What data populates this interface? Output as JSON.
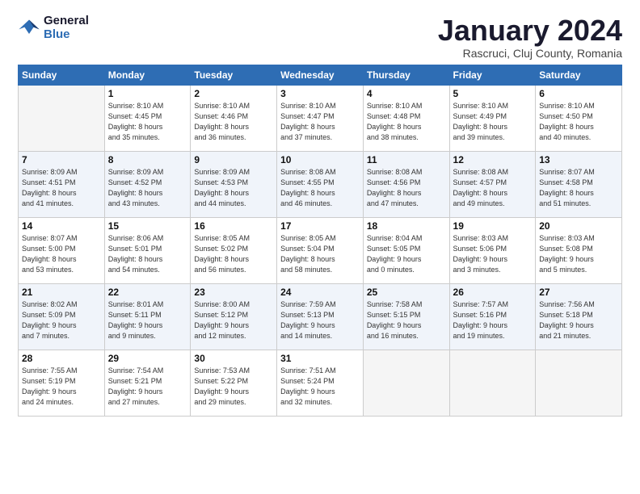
{
  "logo": {
    "line1": "General",
    "line2": "Blue"
  },
  "title": "January 2024",
  "subtitle": "Rascruci, Cluj County, Romania",
  "days_header": [
    "Sunday",
    "Monday",
    "Tuesday",
    "Wednesday",
    "Thursday",
    "Friday",
    "Saturday"
  ],
  "weeks": [
    [
      {
        "num": "",
        "info": ""
      },
      {
        "num": "1",
        "info": "Sunrise: 8:10 AM\nSunset: 4:45 PM\nDaylight: 8 hours\nand 35 minutes."
      },
      {
        "num": "2",
        "info": "Sunrise: 8:10 AM\nSunset: 4:46 PM\nDaylight: 8 hours\nand 36 minutes."
      },
      {
        "num": "3",
        "info": "Sunrise: 8:10 AM\nSunset: 4:47 PM\nDaylight: 8 hours\nand 37 minutes."
      },
      {
        "num": "4",
        "info": "Sunrise: 8:10 AM\nSunset: 4:48 PM\nDaylight: 8 hours\nand 38 minutes."
      },
      {
        "num": "5",
        "info": "Sunrise: 8:10 AM\nSunset: 4:49 PM\nDaylight: 8 hours\nand 39 minutes."
      },
      {
        "num": "6",
        "info": "Sunrise: 8:10 AM\nSunset: 4:50 PM\nDaylight: 8 hours\nand 40 minutes."
      }
    ],
    [
      {
        "num": "7",
        "info": "Sunrise: 8:09 AM\nSunset: 4:51 PM\nDaylight: 8 hours\nand 41 minutes."
      },
      {
        "num": "8",
        "info": "Sunrise: 8:09 AM\nSunset: 4:52 PM\nDaylight: 8 hours\nand 43 minutes."
      },
      {
        "num": "9",
        "info": "Sunrise: 8:09 AM\nSunset: 4:53 PM\nDaylight: 8 hours\nand 44 minutes."
      },
      {
        "num": "10",
        "info": "Sunrise: 8:08 AM\nSunset: 4:55 PM\nDaylight: 8 hours\nand 46 minutes."
      },
      {
        "num": "11",
        "info": "Sunrise: 8:08 AM\nSunset: 4:56 PM\nDaylight: 8 hours\nand 47 minutes."
      },
      {
        "num": "12",
        "info": "Sunrise: 8:08 AM\nSunset: 4:57 PM\nDaylight: 8 hours\nand 49 minutes."
      },
      {
        "num": "13",
        "info": "Sunrise: 8:07 AM\nSunset: 4:58 PM\nDaylight: 8 hours\nand 51 minutes."
      }
    ],
    [
      {
        "num": "14",
        "info": "Sunrise: 8:07 AM\nSunset: 5:00 PM\nDaylight: 8 hours\nand 53 minutes."
      },
      {
        "num": "15",
        "info": "Sunrise: 8:06 AM\nSunset: 5:01 PM\nDaylight: 8 hours\nand 54 minutes."
      },
      {
        "num": "16",
        "info": "Sunrise: 8:05 AM\nSunset: 5:02 PM\nDaylight: 8 hours\nand 56 minutes."
      },
      {
        "num": "17",
        "info": "Sunrise: 8:05 AM\nSunset: 5:04 PM\nDaylight: 8 hours\nand 58 minutes."
      },
      {
        "num": "18",
        "info": "Sunrise: 8:04 AM\nSunset: 5:05 PM\nDaylight: 9 hours\nand 0 minutes."
      },
      {
        "num": "19",
        "info": "Sunrise: 8:03 AM\nSunset: 5:06 PM\nDaylight: 9 hours\nand 3 minutes."
      },
      {
        "num": "20",
        "info": "Sunrise: 8:03 AM\nSunset: 5:08 PM\nDaylight: 9 hours\nand 5 minutes."
      }
    ],
    [
      {
        "num": "21",
        "info": "Sunrise: 8:02 AM\nSunset: 5:09 PM\nDaylight: 9 hours\nand 7 minutes."
      },
      {
        "num": "22",
        "info": "Sunrise: 8:01 AM\nSunset: 5:11 PM\nDaylight: 9 hours\nand 9 minutes."
      },
      {
        "num": "23",
        "info": "Sunrise: 8:00 AM\nSunset: 5:12 PM\nDaylight: 9 hours\nand 12 minutes."
      },
      {
        "num": "24",
        "info": "Sunrise: 7:59 AM\nSunset: 5:13 PM\nDaylight: 9 hours\nand 14 minutes."
      },
      {
        "num": "25",
        "info": "Sunrise: 7:58 AM\nSunset: 5:15 PM\nDaylight: 9 hours\nand 16 minutes."
      },
      {
        "num": "26",
        "info": "Sunrise: 7:57 AM\nSunset: 5:16 PM\nDaylight: 9 hours\nand 19 minutes."
      },
      {
        "num": "27",
        "info": "Sunrise: 7:56 AM\nSunset: 5:18 PM\nDaylight: 9 hours\nand 21 minutes."
      }
    ],
    [
      {
        "num": "28",
        "info": "Sunrise: 7:55 AM\nSunset: 5:19 PM\nDaylight: 9 hours\nand 24 minutes."
      },
      {
        "num": "29",
        "info": "Sunrise: 7:54 AM\nSunset: 5:21 PM\nDaylight: 9 hours\nand 27 minutes."
      },
      {
        "num": "30",
        "info": "Sunrise: 7:53 AM\nSunset: 5:22 PM\nDaylight: 9 hours\nand 29 minutes."
      },
      {
        "num": "31",
        "info": "Sunrise: 7:51 AM\nSunset: 5:24 PM\nDaylight: 9 hours\nand 32 minutes."
      },
      {
        "num": "",
        "info": ""
      },
      {
        "num": "",
        "info": ""
      },
      {
        "num": "",
        "info": ""
      }
    ]
  ]
}
